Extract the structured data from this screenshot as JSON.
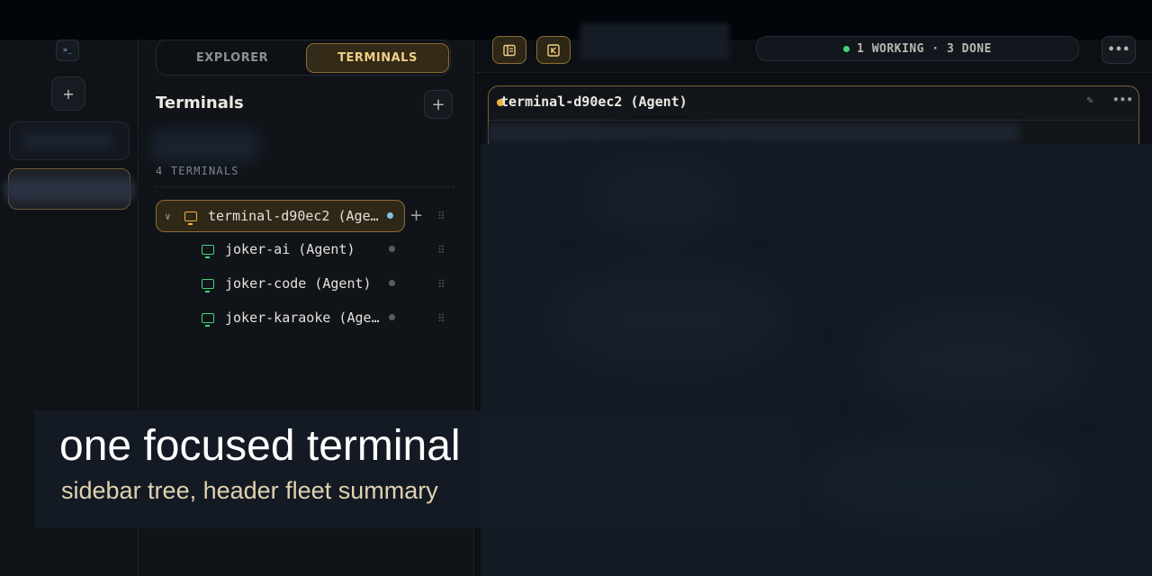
{
  "sidebar": {
    "tabs": [
      {
        "label": "EXPLORER",
        "active": false
      },
      {
        "label": "TERMINALS",
        "active": true
      }
    ],
    "title": "Terminals",
    "add_symbol": "+",
    "count_label": "4 TERMINALS",
    "terminals": [
      {
        "name": "terminal-d90ec2 (Agent)",
        "icon": "monitor-icon",
        "icon_color": "#f0b33a",
        "status_color": "#7ec3e6",
        "expanded": true,
        "active": true
      },
      {
        "name": "joker-ai (Agent)",
        "icon": "monitor-icon",
        "icon_color": "#3fd57a",
        "status_color": "#5a5e64"
      },
      {
        "name": "joker-code (Agent)",
        "icon": "monitor-icon",
        "icon_color": "#3fd57a",
        "status_color": "#5a5e64"
      },
      {
        "name": "joker-karaoke (Agent)",
        "icon": "monitor-icon",
        "icon_color": "#3fd57a",
        "status_color": "#5a5e64"
      }
    ]
  },
  "rail": {
    "add_symbol": "+"
  },
  "header": {
    "status_summary": "1 WORKING · 3 DONE",
    "working_color": "#3fd57a",
    "more_symbol": "•••"
  },
  "terminal": {
    "title": "terminal-d90ec2 (Agent)",
    "status_color": "#f0b33a",
    "more_symbol": "•••"
  },
  "caption": {
    "title": "one focused terminal",
    "subtitle": "sidebar tree, header fleet summary"
  },
  "colors": {
    "accent": "#f0cf85",
    "accent_border": "#8c6d33",
    "background": "#0c1016"
  }
}
